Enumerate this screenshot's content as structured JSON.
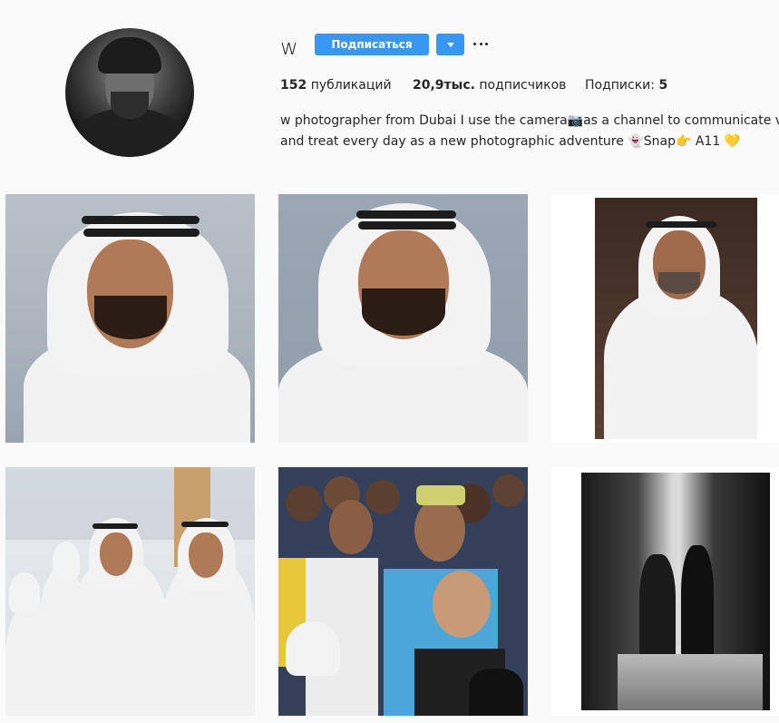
{
  "profile": {
    "username": "w",
    "follow_label": "Подписаться",
    "dropdown_icon": "chevron-down-icon",
    "more_icon": "more-options-icon",
    "posts_count": "152",
    "posts_label": "публикаций",
    "followers_count": "20,9тыс.",
    "followers_label": "подписчиков",
    "following_label": "Подписки:",
    "following_count": "5",
    "bio_line1": "w photographer from Dubai I use the camera📷as a channel to communicate visua",
    "bio_line2": "and treat every day as a new photographic adventure 👻Snap👉 A11 💛"
  },
  "colors": {
    "accent": "#3897f0",
    "text": "#262626",
    "background": "#fafafa"
  },
  "posts": [
    {
      "id": "post-1"
    },
    {
      "id": "post-2"
    },
    {
      "id": "post-3"
    },
    {
      "id": "post-4"
    },
    {
      "id": "post-5"
    },
    {
      "id": "post-6"
    }
  ]
}
